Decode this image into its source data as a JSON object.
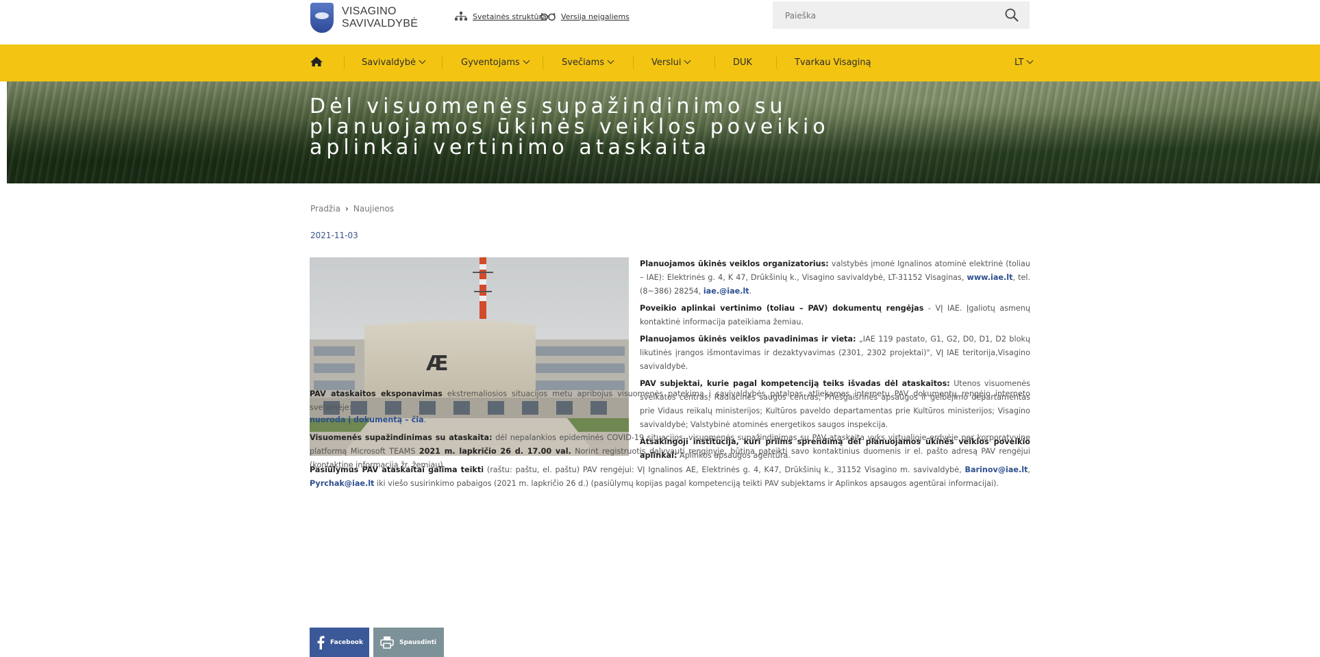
{
  "header": {
    "logo_line1": "VISAGINO",
    "logo_line2": "SAVIVALDYBĖ",
    "structure_link": "Svetainės struktūra",
    "accessibility_link": "Versija neįgaliems",
    "search_placeholder": "Paieška"
  },
  "nav": {
    "items": [
      "Savivaldybė",
      "Gyventojams",
      "Svečiams",
      "Verslui",
      "DUK",
      "Tvarkau Visaginą"
    ],
    "language": "LT"
  },
  "hero": {
    "title": "Dėl visuomenės supažindinimo su planuojamos ūkinės veiklos poveikio aplinkai vertinimo ataskaita"
  },
  "breadcrumb": {
    "home": "Pradžia",
    "current": "Naujienos"
  },
  "article": {
    "date": "2021-11-03",
    "p1_label": "Planuojamos ūkinės veiklos organizatorius:",
    "p1_text": " valstybės įmonė Ignalinos atominė elektrinė (toliau – IAE): Elektrinės g. 4, K 47, Drūkšinių k., Visagino savivaldybė, LT-31152 Visaginas, ",
    "p1_web": "www.iae.lt",
    "p1_tel": ", tel. (8~386) 28254, ",
    "p1_email": "iae.@iae.lt",
    "p1_end": ".",
    "p2_label": "Poveikio aplinkai vertinimo (toliau – PAV) dokumentų rengėjas",
    "p2_text": " - VĮ IAE. Įgaliotų asmenų kontaktinė informacija pateikiama žemiau.",
    "p3_label": "Planuojamos ūkinės veiklos pavadinimas ir vieta:",
    "p3_text": " „IAE 119 pastato, G1, G2, D0, D1, D2 blokų likutinės įrangos išmontavimas ir dezaktyvavimas (2301, 2302 projektai)\", VĮ IAE teritorija,Visagino savivaldybė.",
    "p4_label": "PAV subjektai, kurie pagal kompetenciją teiks išvadas dėl ataskaitos:",
    "p4_text": " Utenos visuomenės sveikatos centras; Radiacinės saugos centras; Priešgaisrinės apsaugos ir gelbėjimo departamentas prie Vidaus reikalų ministerijos; Kultūros paveldo departamentas prie Kultūros ministerijos; Visagino savivaldybė; Valstybinė atominės energetikos saugos inspekcija.",
    "p5_label": "Atsakingoji institucija, kuri priims sprendimą dėl planuojamos ūkinės veiklos poveikio aplinkai:",
    "p5_text": " Aplinkos apsaugos agentūra.",
    "p6_label": "PAV ataskaitos eksponavimas",
    "p6_text": " ekstremaliosios situacijos metu apribojus visuomenės patekimą į savivaldybės patalpas atliekamas internetu PAV dokumentų rengėjo interneto svetainėje:",
    "p7_link": "nuoroda į dokumentą – čia",
    "p7_end": ".",
    "p8_label": "Visuomenės supažindinimas su ataskaita:",
    "p8_text1": " dėl nepalankios epideminės COVID-19 situacijos, visuomenės supažindinimas su PAV ataskaita vyks virtualioje erdvėje per korporatyvinę platformą Microsoft TEAMS ",
    "p8_bold": "2021 m. lapkričio 26 d. 17.00 val.",
    "p8_text2": " Norint registruotis dalyvauti renginyje, būtina pateikti savo kontaktinius duomenis ir el. pašto adresą PAV rengėjui (kontaktinę informaciją žr. žemiau).",
    "p9_label": "Pasiūlymus PAV ataskaitai galima teikti",
    "p9_text1": " (raštu: paštu, el. paštu) PAV rengėjui: VĮ Ignalinos AE, Elektrinės g. 4, K47, Drūkšinių k., 31152 Visagino m. savivaldybė, ",
    "p9_email1": "Barinov@iae.lt",
    "p9_sep": ", ",
    "p9_email2": "Pyrchak@iae.lt",
    "p9_text2": " iki viešo susirinkimo pabaigos (2021 m. lapkričio 26 d.) (pasiūlymų kopijas pagal kompetenciją teikti PAV subjektams ir Aplinkos apsaugos agentūrai informacijai).",
    "photo_sign": "Æ"
  },
  "share": {
    "facebook": "Facebook",
    "print": "Spausdinti"
  },
  "colors": {
    "nav_bg": "#f3c512",
    "link": "#2c4f8f",
    "facebook": "#3b5998",
    "print": "#7c9198"
  }
}
